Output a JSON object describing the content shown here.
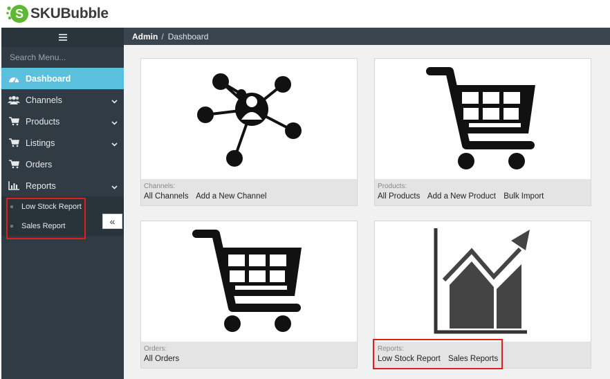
{
  "brand": {
    "name": "SKUBubble",
    "accent": "#5fb832"
  },
  "sidebar": {
    "toggle_icon": "hamburger-icon",
    "search_placeholder": "Search Menu...",
    "items": [
      {
        "label": "Dashboard",
        "icon": "speedometer-icon",
        "active": true
      },
      {
        "label": "Channels",
        "icon": "users-icon",
        "expandable": true
      },
      {
        "label": "Products",
        "icon": "cart-icon",
        "expandable": true
      },
      {
        "label": "Listings",
        "icon": "cart-icon",
        "expandable": true
      },
      {
        "label": "Orders",
        "icon": "cart-icon"
      },
      {
        "label": "Reports",
        "icon": "bar-chart-icon",
        "expandable": true
      }
    ],
    "sub_items": [
      {
        "label": "Low Stock Report"
      },
      {
        "label": "Sales Report"
      }
    ],
    "collapse_glyph": "«"
  },
  "header": {
    "breadcrumb_root": "Admin",
    "breadcrumb_sep": "/",
    "breadcrumb_current": "Dashboard"
  },
  "cards": [
    {
      "title": "Channels:",
      "icon": "network-people-icon",
      "links": [
        "All Channels",
        "Add a New Channel"
      ]
    },
    {
      "title": "Products:",
      "icon": "cart-icon",
      "links": [
        "All Products",
        "Add a New Product",
        "Bulk Import"
      ]
    },
    {
      "title": "Orders:",
      "icon": "cart-icon",
      "links": [
        "All Orders"
      ]
    },
    {
      "title": "Reports:",
      "icon": "growth-chart-icon",
      "links": [
        "Low Stock Report",
        "Sales Reports"
      ]
    }
  ],
  "colors": {
    "sidebar_bg": "#303b43",
    "active_item": "#5bc0de",
    "header_bg": "#38454e",
    "highlight": "#e01e1e"
  }
}
